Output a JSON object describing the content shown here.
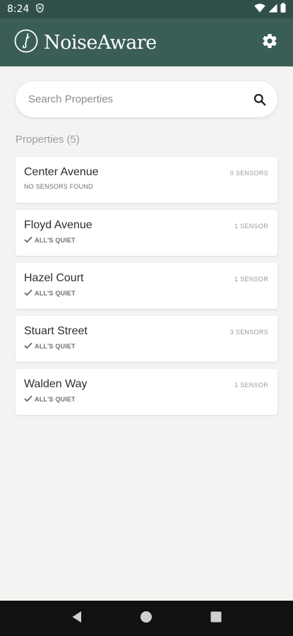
{
  "status_bar": {
    "time": "8:24",
    "icons": [
      "shield-icon",
      "wifi-icon",
      "signal-icon",
      "battery-icon"
    ]
  },
  "header": {
    "title": "NoiseAware",
    "logo_icon": "noiseaware-logo-icon",
    "settings_icon": "gear-icon"
  },
  "search": {
    "placeholder": "Search Properties",
    "value": "",
    "icon": "search-icon"
  },
  "properties": {
    "heading": "Properties (5)",
    "items": [
      {
        "name": "Center Avenue",
        "sensors": "0 SENSORS",
        "status": "NO SENSORS FOUND",
        "status_icon": ""
      },
      {
        "name": "Floyd Avenue",
        "sensors": "1 SENSOR",
        "status": "ALL'S QUIET",
        "status_icon": "check-icon"
      },
      {
        "name": "Hazel Court",
        "sensors": "1 SENSOR",
        "status": "ALL'S QUIET",
        "status_icon": "check-icon"
      },
      {
        "name": "Stuart Street",
        "sensors": "3 SENSORS",
        "status": "ALL'S QUIET",
        "status_icon": "check-icon"
      },
      {
        "name": "Walden Way",
        "sensors": "1 SENSOR",
        "status": "ALL'S QUIET",
        "status_icon": "check-icon"
      }
    ]
  },
  "nav_bar": {
    "buttons": [
      "back-icon",
      "home-icon",
      "recents-icon"
    ]
  },
  "colors": {
    "primary": "#3a5e56",
    "status_bar": "#2f4f48",
    "background": "#f4f3f1"
  }
}
